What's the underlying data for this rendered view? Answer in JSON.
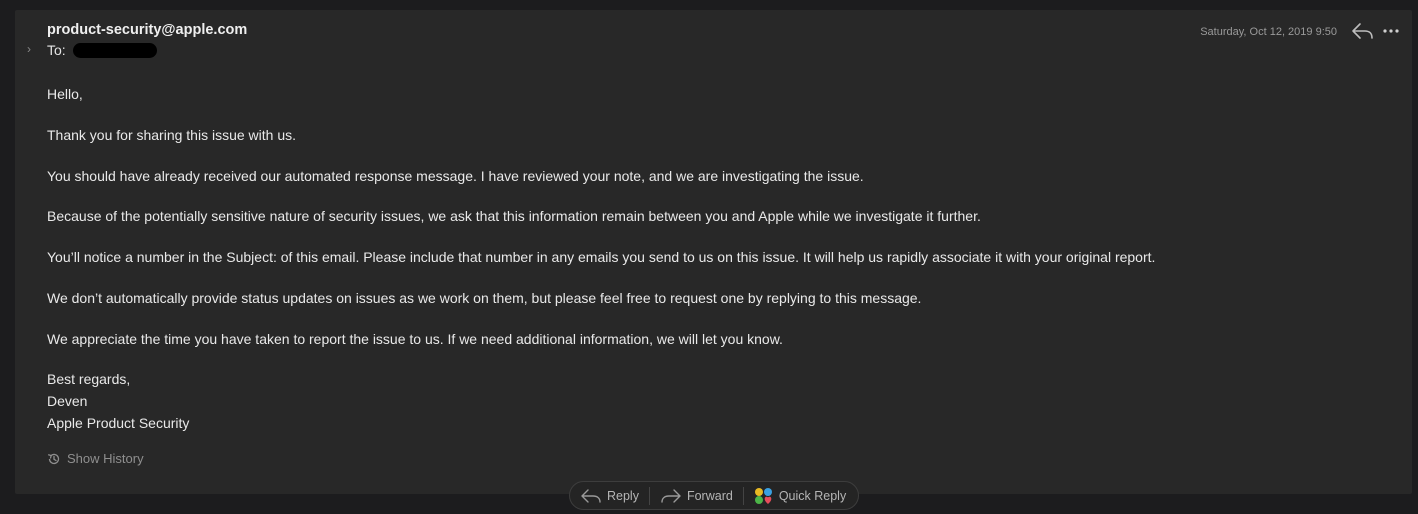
{
  "header": {
    "sender": "product-security@apple.com",
    "to_label": "To:",
    "date": "Saturday, Oct 12, 2019 9:50"
  },
  "body": {
    "paragraphs": [
      "Hello,",
      "Thank you for sharing this issue with us.",
      "You should have already received our automated response message. I have reviewed your note, and we are investigating the issue.",
      "Because of the potentially sensitive nature of security issues, we ask that this information remain between you and Apple while we investigate it further.",
      "You’ll notice a number in the Subject: of this email. Please include that number in any emails you send to us on this issue. It will help us rapidly associate it with your original report.",
      "We don’t automatically provide status updates on issues as we work on them, but please feel free to request one by replying to this message.",
      "We appreciate the time you have taken to report the issue to us. If we need additional information, we will let you know."
    ],
    "signature": [
      "Best regards,",
      "Deven",
      "Apple Product Security"
    ]
  },
  "show_history_label": "Show History",
  "toolbar": {
    "reply": "Reply",
    "forward": "Forward",
    "quick_reply": "Quick Reply"
  },
  "icons": {
    "expand": "chevron-right-icon",
    "header_reply": "reply-arrow-icon",
    "more": "ellipsis-icon",
    "history": "history-icon",
    "reply": "reply-arrow-icon",
    "forward": "forward-arrow-icon",
    "quick_reply": "quick-reply-icon"
  },
  "colors": {
    "background": "#1c1c1e",
    "card": "#282828",
    "text": "#e9e9e9",
    "muted": "#8f8f8f"
  }
}
